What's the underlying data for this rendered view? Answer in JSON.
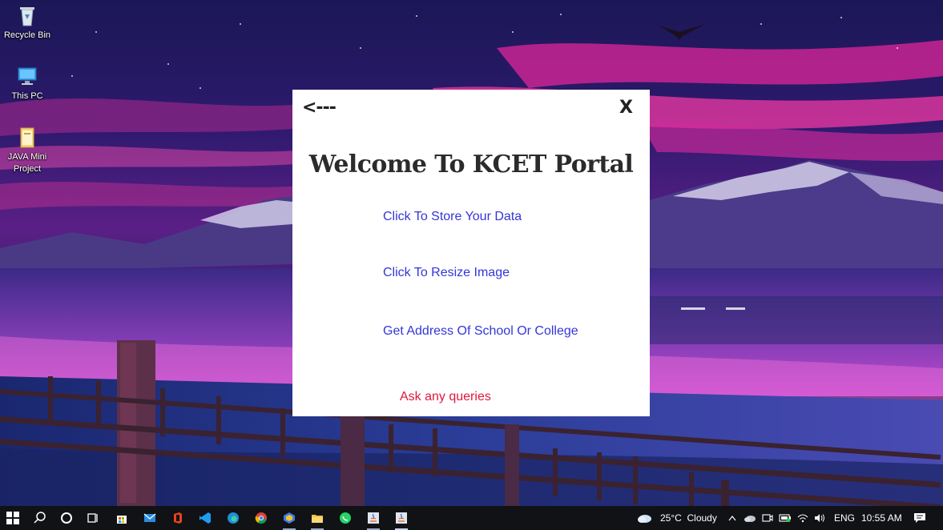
{
  "desktop": {
    "icons": [
      {
        "label": "Recycle Bin",
        "icon": "recycle-bin-icon"
      },
      {
        "label": "This PC",
        "icon": "computer-icon"
      },
      {
        "label": "JAVA Mini Project",
        "label_line1": "JAVA Mini",
        "label_line2": "Project",
        "icon": "folder-icon"
      }
    ]
  },
  "dialog": {
    "back_label": "<---",
    "close_label": "X",
    "title": "Welcome To KCET Portal",
    "links": {
      "store_data": "Click To Store Your Data",
      "resize_image": "Click To Resize Image",
      "address": "Get Address Of School Or College",
      "queries": "Ask any queries"
    },
    "colors": {
      "link": "#3436d8",
      "queries": "#e0183c",
      "title": "#2b2b2b"
    }
  },
  "taskbar": {
    "apps": [
      "windows-start-icon",
      "search-icon",
      "cortana-icon",
      "task-view-icon",
      "store-icon",
      "mail-icon",
      "office-icon",
      "vscode-icon",
      "edge-icon",
      "chrome-icon",
      "app-icon",
      "file-explorer-icon",
      "whatsapp-icon",
      "java-icon",
      "java-icon"
    ],
    "weather": {
      "temp": "25°C",
      "condition": "Cloudy"
    },
    "language": "ENG",
    "time": "10:55 AM"
  }
}
